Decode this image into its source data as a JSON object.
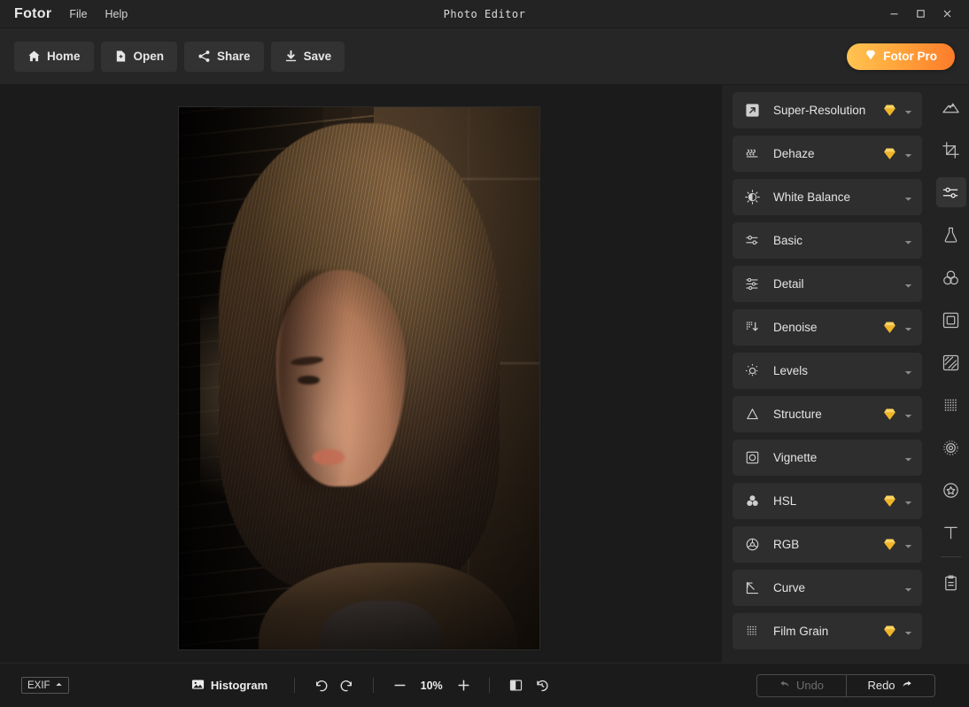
{
  "window": {
    "brand": "Fotor",
    "title": "Photo Editor",
    "menus": [
      {
        "label": "File"
      },
      {
        "label": "Help"
      }
    ],
    "controls": {
      "minimize": "minimize-icon",
      "maximize": "maximize-icon",
      "close": "close-icon"
    }
  },
  "toolbar": {
    "buttons": [
      {
        "label": "Home",
        "icon": "home-icon"
      },
      {
        "label": "Open",
        "icon": "open-file-icon"
      },
      {
        "label": "Share",
        "icon": "share-icon"
      },
      {
        "label": "Save",
        "icon": "download-save-icon"
      }
    ],
    "pro": {
      "label": "Fotor Pro",
      "icon": "diamond-icon"
    }
  },
  "canvas": {
    "photo_alt": "portrait-photo-woman-in-sunlight"
  },
  "adjust_panel": {
    "items": [
      {
        "label": "Super-Resolution",
        "icon": "super-resolution-icon",
        "pro": true
      },
      {
        "label": "Dehaze",
        "icon": "dehaze-icon",
        "pro": true
      },
      {
        "label": "White Balance",
        "icon": "white-balance-icon",
        "pro": false
      },
      {
        "label": "Basic",
        "icon": "sliders-icon",
        "pro": false
      },
      {
        "label": "Detail",
        "icon": "detail-sliders-icon",
        "pro": false
      },
      {
        "label": "Denoise",
        "icon": "denoise-icon",
        "pro": true
      },
      {
        "label": "Levels",
        "icon": "levels-icon",
        "pro": false
      },
      {
        "label": "Structure",
        "icon": "structure-triangle-icon",
        "pro": true
      },
      {
        "label": "Vignette",
        "icon": "vignette-icon",
        "pro": false
      },
      {
        "label": "HSL",
        "icon": "hsl-circles-icon",
        "pro": true
      },
      {
        "label": "RGB",
        "icon": "rgb-wheel-icon",
        "pro": true
      },
      {
        "label": "Curve",
        "icon": "curve-icon",
        "pro": false
      },
      {
        "label": "Film Grain",
        "icon": "film-grain-icon",
        "pro": true
      }
    ]
  },
  "rail": {
    "items": [
      {
        "name": "scenery",
        "icon": "mountain-icon",
        "active": false
      },
      {
        "name": "crop",
        "icon": "crop-icon",
        "active": false
      },
      {
        "name": "adjust",
        "icon": "adjust-sliders-icon",
        "active": true
      },
      {
        "name": "effects",
        "icon": "flask-icon",
        "active": false
      },
      {
        "name": "color",
        "icon": "color-circles-icon",
        "active": false
      },
      {
        "name": "frame",
        "icon": "frame-icon",
        "active": false
      },
      {
        "name": "tilt-shift",
        "icon": "tilt-shift-icon",
        "active": false
      },
      {
        "name": "texture",
        "icon": "texture-grid-icon",
        "active": false
      },
      {
        "name": "focus",
        "icon": "focus-ring-icon",
        "active": false
      },
      {
        "name": "sticker",
        "icon": "star-badge-icon",
        "active": false
      },
      {
        "name": "text",
        "icon": "text-t-icon",
        "active": false
      },
      {
        "name": "notes",
        "icon": "clipboard-icon",
        "active": false
      }
    ]
  },
  "bottombar": {
    "exif": {
      "label": "EXIF",
      "icon": "chevron-up-icon"
    },
    "histogram": {
      "label": "Histogram",
      "icon": "image-icon"
    },
    "undo_icon": "undo-arrow-icon",
    "redo_icon": "redo-arrow-icon",
    "zoom_out": "minus-icon",
    "zoom_value": "10%",
    "zoom_in": "plus-icon",
    "compare": "compare-split-icon",
    "reset": "reset-history-icon",
    "undo": {
      "label": "Undo",
      "enabled": false
    },
    "redo": {
      "label": "Redo",
      "enabled": true
    }
  },
  "colors": {
    "accent_pro_start": "#ffc452",
    "accent_pro_end": "#fc7b2a",
    "diamond": "#f5c242",
    "panel_bg": "#232323",
    "item_bg": "#2e2e2e",
    "canvas_bg": "#1b1b1b",
    "toolbar_bg": "#262626",
    "text": "#e4e4e4"
  }
}
